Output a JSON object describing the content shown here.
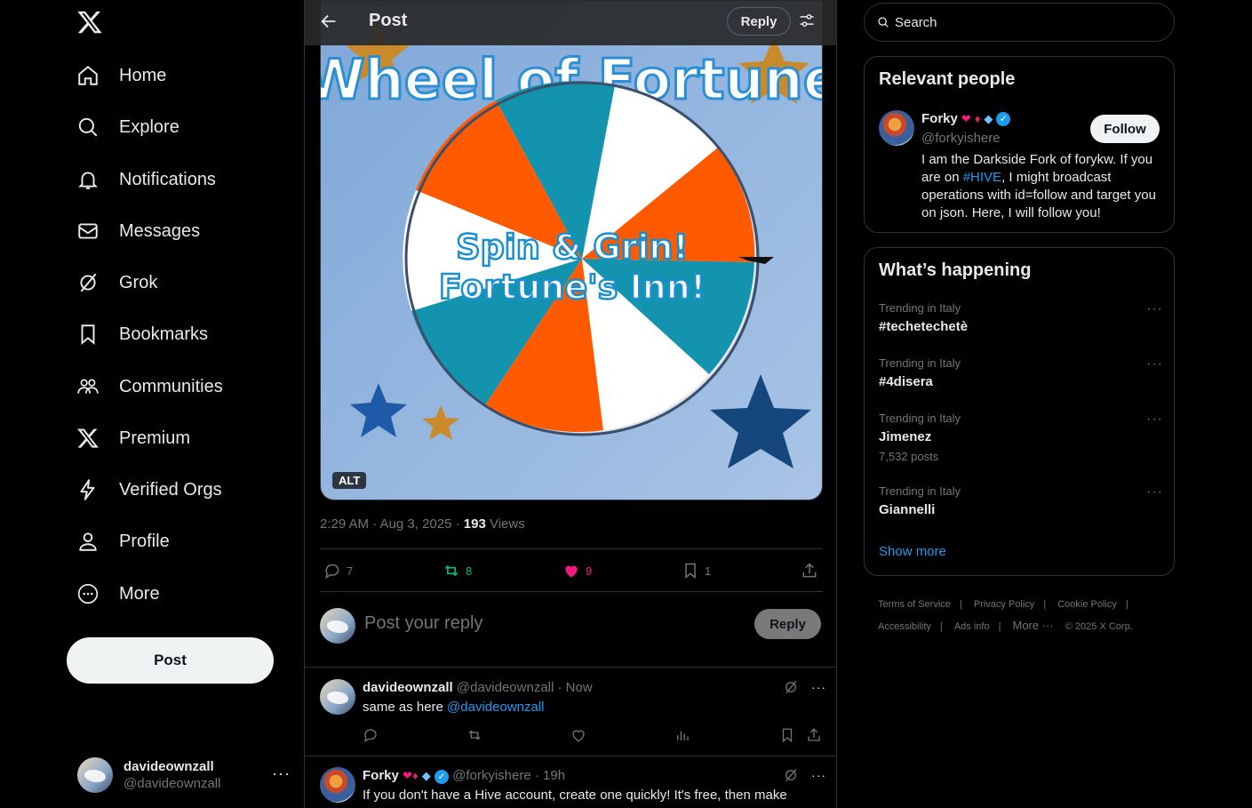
{
  "nav": {
    "items": [
      {
        "label": "Home",
        "icon": "home-icon"
      },
      {
        "label": "Explore",
        "icon": "search-icon"
      },
      {
        "label": "Notifications",
        "icon": "bell-icon"
      },
      {
        "label": "Messages",
        "icon": "mail-icon"
      },
      {
        "label": "Grok",
        "icon": "grok-icon"
      },
      {
        "label": "Bookmarks",
        "icon": "bookmark-icon"
      },
      {
        "label": "Communities",
        "icon": "communities-icon"
      },
      {
        "label": "Premium",
        "icon": "x-logo-icon"
      },
      {
        "label": "Verified Orgs",
        "icon": "lightning-icon"
      },
      {
        "label": "Profile",
        "icon": "person-icon"
      },
      {
        "label": "More",
        "icon": "more-circle-icon"
      }
    ],
    "post_label": "Post"
  },
  "account": {
    "name": "davideownzall",
    "handle": "@davideownzall",
    "more": "···"
  },
  "topbar": {
    "title": "Post",
    "reply_label": "Reply"
  },
  "media": {
    "alt_label": "ALT",
    "arc_text": "Wheel of Fortune",
    "center_line1": "Spin & Grin!",
    "center_line2": "Fortune's Inn!"
  },
  "post_meta": {
    "time": "2:29 AM · Aug 3, 2025 · ",
    "views_count": "193",
    "views_label": " Views"
  },
  "post_actions": {
    "replies": "7",
    "reposts": "8",
    "likes": "9",
    "bookmarks": "1"
  },
  "compose": {
    "placeholder": "Post your reply",
    "reply_label": "Reply"
  },
  "replies": [
    {
      "name": "davideownzall",
      "handle": "@davideownzall · Now",
      "text_prefix": "same as here ",
      "mention": "@davideownzall"
    },
    {
      "name": "Forky",
      "handle": "@forkyishere · 19h",
      "text": "If you don't have a Hive account, create one quickly! It's free, then make"
    }
  ],
  "right": {
    "search_placeholder": "Search",
    "relevant_title": "Relevant people",
    "person": {
      "name": "Forky",
      "handle": "@forkyishere",
      "follow_label": "Follow",
      "bio_1": "I am the Darkside Fork of forykw. If you are on ",
      "bio_hashtag": "#HIVE",
      "bio_2": ", I might broadcast operations with id=follow and target you on json. Here, I will follow you!"
    },
    "happening_title": "What’s happening",
    "trends": [
      {
        "context": "Trending in Italy",
        "tag": "#techetechetè",
        "posts": ""
      },
      {
        "context": "Trending in Italy",
        "tag": "#4disera",
        "posts": ""
      },
      {
        "context": "Trending in Italy",
        "tag": "Jimenez",
        "posts": "7,532 posts"
      },
      {
        "context": "Trending in Italy",
        "tag": "Giannelli",
        "posts": ""
      }
    ],
    "show_more": "Show more",
    "footer": [
      "Terms of Service",
      "Privacy Policy",
      "Cookie Policy",
      "Accessibility",
      "Ads info",
      "More ···",
      "© 2025 X Corp."
    ]
  },
  "colors": {
    "accent": "#1d9bf0",
    "like": "#f91880",
    "repost": "#00ba7c",
    "wheel_orange": "#ff5a00",
    "wheel_teal": "#1493ae"
  }
}
